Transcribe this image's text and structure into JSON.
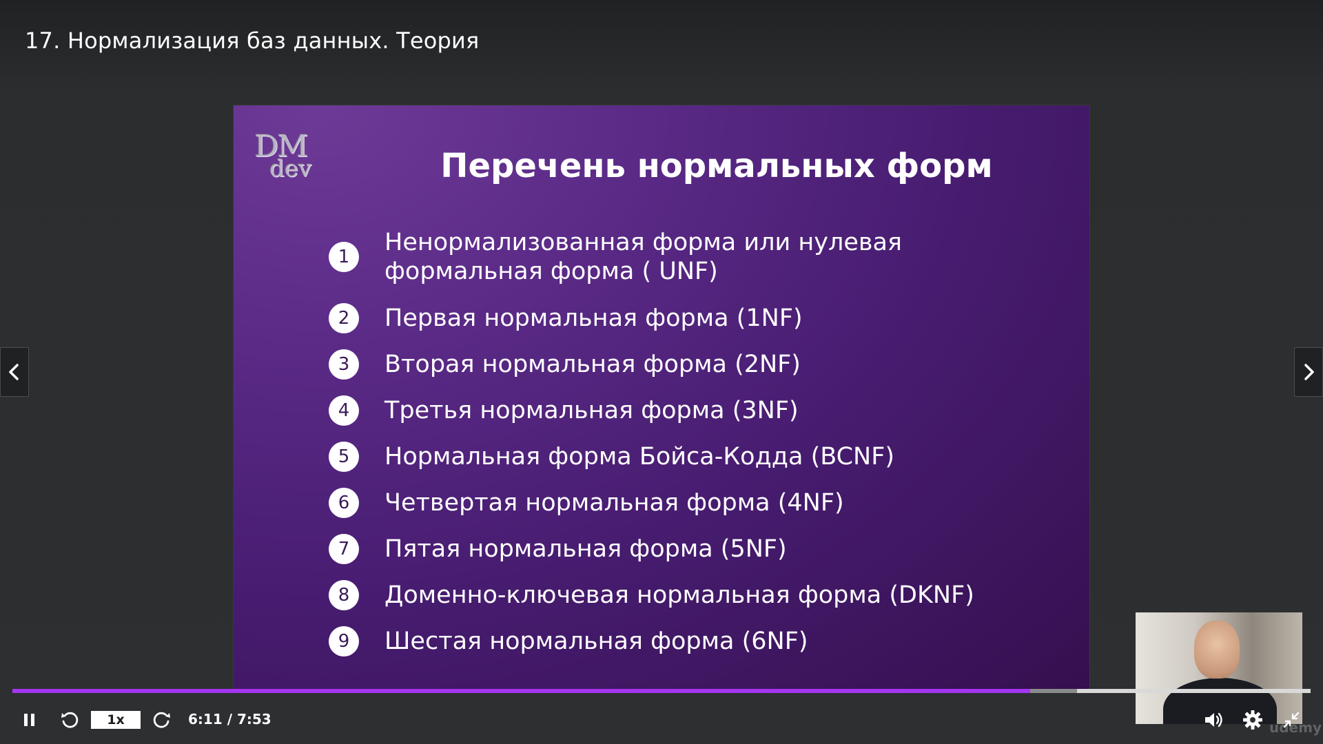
{
  "header": {
    "lecture_title": "17. Нормализация баз данных. Теория"
  },
  "slide": {
    "logo_line1": "DM",
    "logo_line2": "dev",
    "heading": "Перечень нормальных форм",
    "items": [
      {
        "num": "1",
        "text": "Ненормализованная форма или нулевая формальная форма ( UNF)"
      },
      {
        "num": "2",
        "text": "Первая нормальная форма (1NF)"
      },
      {
        "num": "3",
        "text": "Вторая нормальная форма (2NF)"
      },
      {
        "num": "4",
        "text": "Третья нормальная форма (3NF)"
      },
      {
        "num": "5",
        "text": "Нормальная форма Бойса-Кодда (BCNF)"
      },
      {
        "num": "6",
        "text": "Четвертая нормальная форма (4NF)"
      },
      {
        "num": "7",
        "text": "Пятая нормальная форма (5NF)"
      },
      {
        "num": "8",
        "text": "Доменно-ключевая нормальная форма (DKNF)"
      },
      {
        "num": "9",
        "text": "Шестая нормальная форма (6NF)"
      }
    ]
  },
  "navigation": {
    "prev_icon": "chevron-left-icon",
    "next_icon": "chevron-right-icon"
  },
  "player": {
    "play_state_icon": "pause-icon",
    "rewind_icon": "rewind-icon",
    "forward_icon": "forward-icon",
    "speed_label": "1x",
    "time_display": "6:11 / 7:53",
    "progress_fraction": 0.784,
    "buffered_fraction": 0.82,
    "volume_icon": "volume-icon",
    "settings_icon": "gear-icon",
    "exit_fullscreen_icon": "exit-fullscreen-icon",
    "watermark": "udemy",
    "accent_color": "#a435f0"
  }
}
